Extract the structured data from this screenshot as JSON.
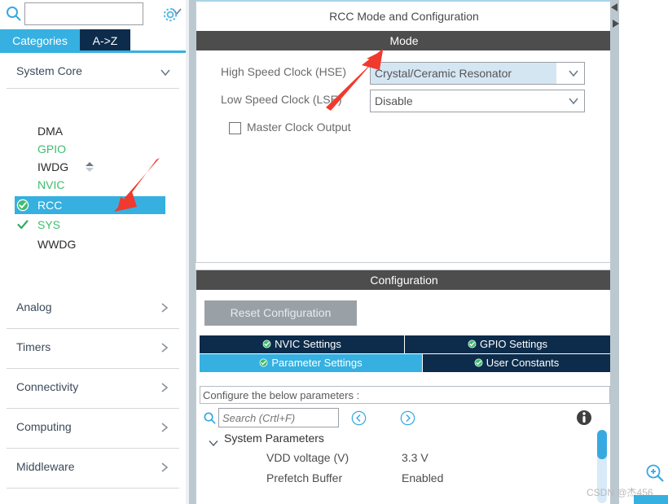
{
  "sidebar": {
    "search": {
      "placeholder": "",
      "value": "",
      "icon": "search-icon"
    },
    "gear_icon": "gear-icon",
    "tabs": [
      {
        "label": "Categories",
        "active": true
      },
      {
        "label": "A->Z",
        "active": false
      }
    ],
    "groups": [
      {
        "label": "System Core",
        "expanded": true,
        "items": [
          {
            "label": "DMA",
            "state": "plain",
            "icon": "none"
          },
          {
            "label": "GPIO",
            "state": "green",
            "icon": "none"
          },
          {
            "label": "IWDG",
            "state": "plain",
            "icon": "none"
          },
          {
            "label": "NVIC",
            "state": "green",
            "icon": "none"
          },
          {
            "label": "RCC",
            "state": "selected",
            "icon": "check-circle-icon"
          },
          {
            "label": "SYS",
            "state": "green",
            "icon": "check-icon"
          },
          {
            "label": "WWDG",
            "state": "plain",
            "icon": "none"
          }
        ]
      }
    ],
    "categories": [
      {
        "label": "Analog"
      },
      {
        "label": "Timers"
      },
      {
        "label": "Connectivity"
      },
      {
        "label": "Computing"
      },
      {
        "label": "Middleware"
      }
    ]
  },
  "mode_panel": {
    "title": "RCC Mode and Configuration",
    "section_label": "Mode",
    "fields": [
      {
        "label": "High Speed Clock (HSE)",
        "value": "Crystal/Ceramic Resonator",
        "highlighted": true
      },
      {
        "label": "Low Speed Clock (LSE)",
        "value": "Disable",
        "highlighted": false
      }
    ],
    "checkbox": {
      "label": "Master Clock Output",
      "checked": false
    }
  },
  "config_panel": {
    "section_label": "Configuration",
    "reset_button": "Reset Configuration",
    "tabs_row1": [
      {
        "label": "NVIC Settings",
        "active": false
      },
      {
        "label": "GPIO Settings",
        "active": false
      }
    ],
    "tabs_row2": [
      {
        "label": "Parameter Settings",
        "active": true
      },
      {
        "label": "User Constants",
        "active": false
      }
    ],
    "configure_note": "Configure the below parameters :",
    "search_placeholder": "Search (Crtl+F)",
    "search_value": "",
    "nav_prev_icon": "chevron-left-circle-icon",
    "nav_next_icon": "chevron-right-circle-icon",
    "info_icon": "info-icon",
    "param_group": {
      "label": "System Parameters",
      "expanded": true,
      "rows": [
        {
          "name": "VDD voltage (V)",
          "value": "3.3 V"
        },
        {
          "name": "Prefetch Buffer",
          "value": "Enabled"
        }
      ]
    }
  },
  "overlay": {
    "watermark": "CSDN @杰456",
    "zoom_icon": "zoom-in-icon",
    "annotation_arrows": 2
  },
  "colors": {
    "accent_blue": "#36b0e0",
    "navy": "#0d2c4b",
    "dark_bar": "#4d4d4d",
    "green": "#3fbd6e",
    "highlight_field": "#d5e6f3",
    "annotation_red": "#f03a2e"
  }
}
